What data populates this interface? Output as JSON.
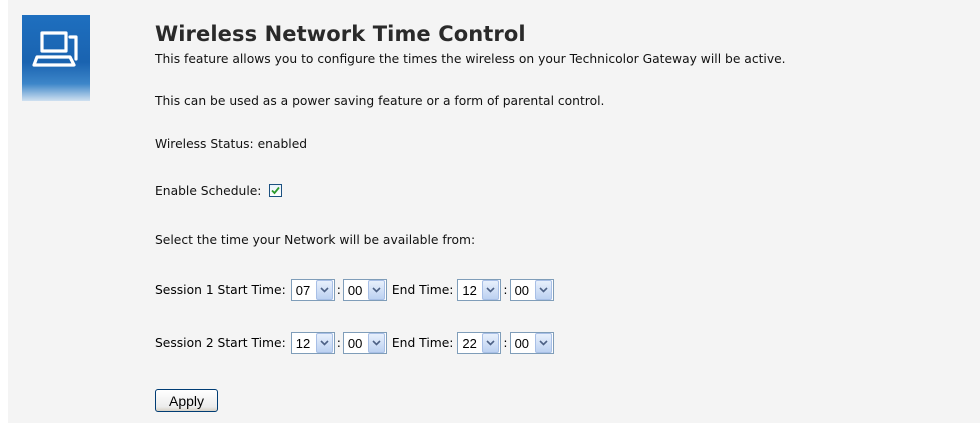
{
  "header": {
    "title": "Wireless Network Time Control",
    "description": "This feature allows you to configure the times the wireless on your Technicolor Gateway will be active."
  },
  "info": {
    "power_saving": "This can be used as a power saving feature or a form of parental control.",
    "wireless_status": "Wireless Status: enabled",
    "enable_schedule_label": "Enable Schedule:",
    "enable_schedule_checked": true,
    "select_time_prompt": "Select the time your Network will be available from:"
  },
  "sessions": [
    {
      "start_label": "Session 1 Start Time:",
      "start_hour": "07",
      "start_minute": "00",
      "end_label": "End Time:",
      "end_hour": "12",
      "end_minute": "00"
    },
    {
      "start_label": "Session 2 Start Time:",
      "start_hour": "12",
      "start_minute": "00",
      "end_label": "End Time:",
      "end_hour": "22",
      "end_minute": "00"
    }
  ],
  "separator": ":",
  "apply_label": "Apply",
  "icons": {
    "header": "network-computer-icon",
    "dropdown": "chevron-down-icon",
    "check": "checkmark-icon"
  },
  "colors": {
    "icon_bg": "#1a63b0",
    "page_bg": "#f4f4f4",
    "title": "#2a2a2a",
    "checkmark": "#2c9a2c"
  }
}
